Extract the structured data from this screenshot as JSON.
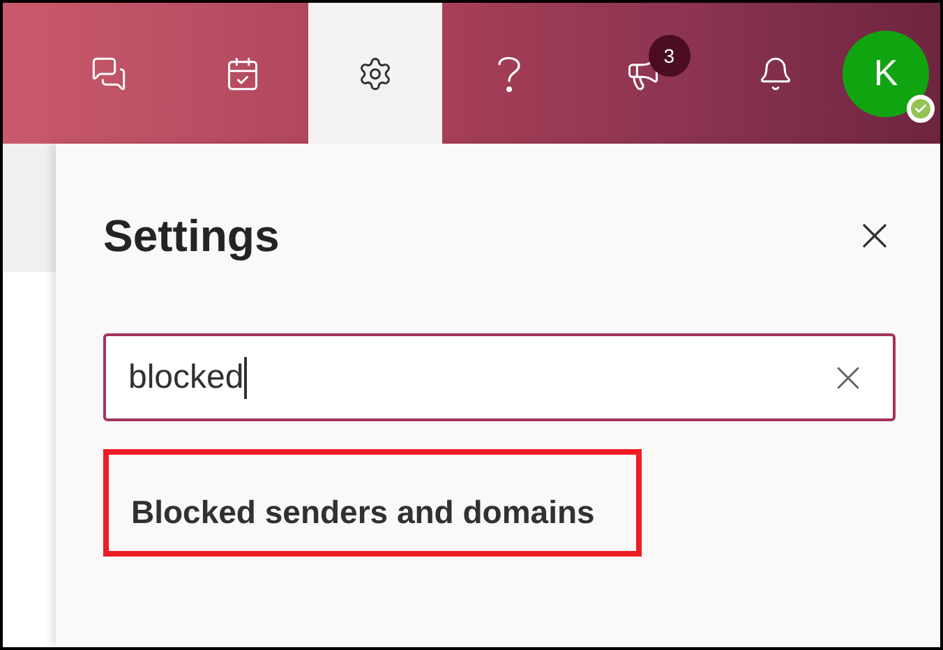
{
  "toolbar": {
    "buttons": [
      {
        "kind": "chat",
        "selected": false
      },
      {
        "kind": "calendar",
        "selected": false
      },
      {
        "kind": "settings",
        "selected": true
      },
      {
        "kind": "help",
        "selected": false
      },
      {
        "kind": "announcements",
        "selected": false,
        "badge": "3"
      },
      {
        "kind": "notifications",
        "selected": false
      }
    ],
    "avatar": {
      "initial": "K",
      "online": true
    }
  },
  "settings_panel": {
    "title": "Settings",
    "search": {
      "value": "blocked"
    },
    "results": [
      {
        "label": "Blocked senders and domains",
        "highlighted": true
      }
    ]
  }
}
